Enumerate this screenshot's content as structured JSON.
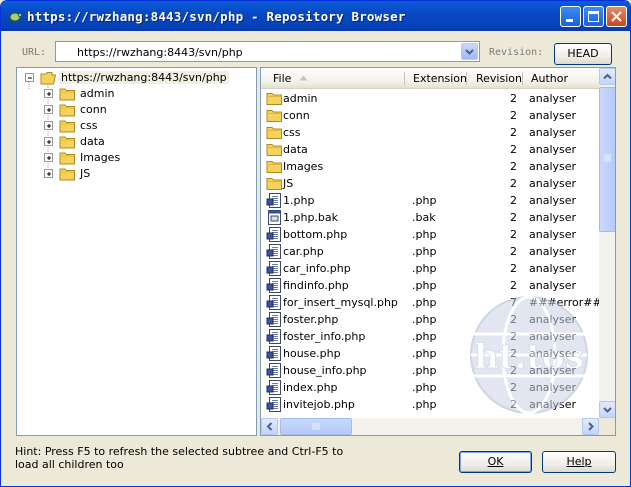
{
  "window": {
    "title": "https://rwzhang:8443/svn/php - Repository Browser"
  },
  "toolbar": {
    "url_label": "URL:",
    "url_value": "https://rwzhang:8443/svn/php",
    "revision_label": "Revision:",
    "head_button": "HEAD"
  },
  "tree": {
    "root": "https://rwzhang:8443/svn/php",
    "children": [
      "admin",
      "conn",
      "css",
      "data",
      "Images",
      "JS"
    ]
  },
  "list": {
    "columns": [
      "File",
      "Extension",
      "Revision",
      "Author"
    ],
    "rows": [
      {
        "name": "admin",
        "ext": "",
        "rev": "2",
        "author": "analyser",
        "icon": "folder-icon"
      },
      {
        "name": "conn",
        "ext": "",
        "rev": "2",
        "author": "analyser",
        "icon": "folder-icon"
      },
      {
        "name": "css",
        "ext": "",
        "rev": "2",
        "author": "analyser",
        "icon": "folder-icon"
      },
      {
        "name": "data",
        "ext": "",
        "rev": "2",
        "author": "analyser",
        "icon": "folder-icon"
      },
      {
        "name": "Images",
        "ext": "",
        "rev": "2",
        "author": "analyser",
        "icon": "folder-icon"
      },
      {
        "name": "JS",
        "ext": "",
        "rev": "2",
        "author": "analyser",
        "icon": "folder-icon"
      },
      {
        "name": "1.php",
        "ext": ".php",
        "rev": "2",
        "author": "analyser",
        "icon": "php-file-icon"
      },
      {
        "name": "1.php.bak",
        "ext": ".bak",
        "rev": "2",
        "author": "analyser",
        "icon": "bak-file-icon"
      },
      {
        "name": "bottom.php",
        "ext": ".php",
        "rev": "2",
        "author": "analyser",
        "icon": "php-file-icon"
      },
      {
        "name": "car.php",
        "ext": ".php",
        "rev": "2",
        "author": "analyser",
        "icon": "php-file-icon"
      },
      {
        "name": "car_info.php",
        "ext": ".php",
        "rev": "2",
        "author": "analyser",
        "icon": "php-file-icon"
      },
      {
        "name": "findinfo.php",
        "ext": ".php",
        "rev": "2",
        "author": "analyser",
        "icon": "php-file-icon"
      },
      {
        "name": "for_insert_mysql.php",
        "ext": ".php",
        "rev": "7",
        "author": "###error###",
        "icon": "php-file-icon"
      },
      {
        "name": "foster.php",
        "ext": ".php",
        "rev": "2",
        "author": "analyser",
        "icon": "php-file-icon"
      },
      {
        "name": "foster_info.php",
        "ext": ".php",
        "rev": "2",
        "author": "analyser",
        "icon": "php-file-icon"
      },
      {
        "name": "house.php",
        "ext": ".php",
        "rev": "2",
        "author": "analyser",
        "icon": "php-file-icon"
      },
      {
        "name": "house_info.php",
        "ext": ".php",
        "rev": "2",
        "author": "analyser",
        "icon": "php-file-icon"
      },
      {
        "name": "index.php",
        "ext": ".php",
        "rev": "2",
        "author": "analyser",
        "icon": "php-file-icon"
      },
      {
        "name": "invitejob.php",
        "ext": ".php",
        "rev": "2",
        "author": "analyser",
        "icon": "php-file-icon"
      }
    ]
  },
  "watermark_text": "ht.tos",
  "hint": "Hint: Press F5 to refresh the selected subtree and Ctrl-F5 to load all children too",
  "buttons": {
    "ok": "OK",
    "help": "Help"
  },
  "colors": {
    "titlebar": "#0a5bd8",
    "window_bg": "#ece9d8",
    "folder": "#f5d25c",
    "error_text": "#000000"
  }
}
